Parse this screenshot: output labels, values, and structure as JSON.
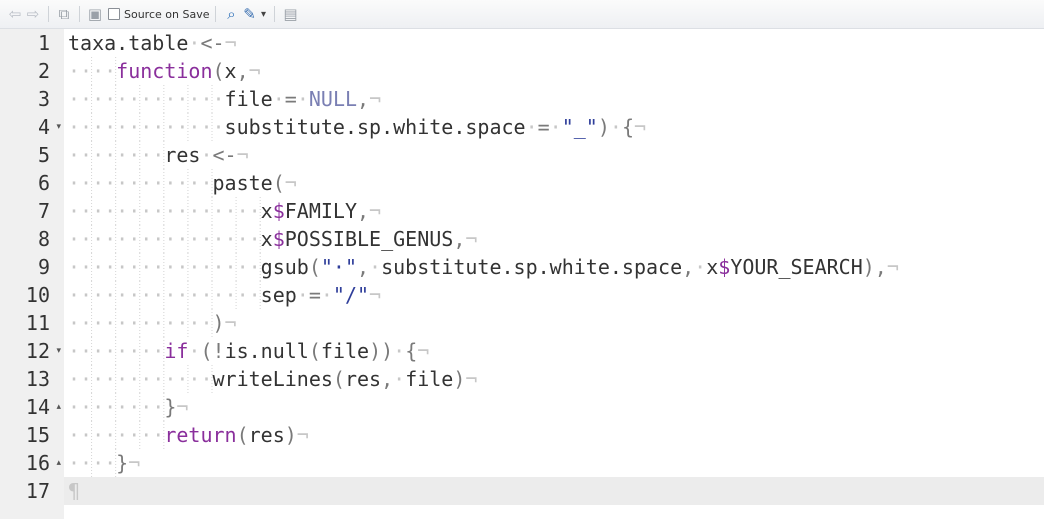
{
  "toolbar": {
    "items": [
      {
        "name": "back-icon",
        "type": "icon",
        "glyph": "⇦",
        "color": "#b9bec6"
      },
      {
        "name": "forward-icon",
        "type": "icon",
        "glyph": "⇨",
        "color": "#b9bec6"
      },
      {
        "name": "sep"
      },
      {
        "name": "show-in-window-icon",
        "type": "icon",
        "glyph": "⧉",
        "color": "#9aa0a8"
      },
      {
        "name": "sep"
      },
      {
        "name": "save-icon",
        "type": "icon",
        "glyph": "▣",
        "color": "#9aa0a8"
      },
      {
        "name": "source-on-save-checkbox",
        "type": "checkbox",
        "label": "Source on Save",
        "checked": false
      },
      {
        "name": "sep"
      },
      {
        "name": "search-icon",
        "type": "icon",
        "glyph": "⌕",
        "color": "#2d6fb8"
      },
      {
        "name": "code-tools-icon",
        "type": "icon",
        "glyph": "✎",
        "color": "#3a6fb0"
      },
      {
        "name": "dropdown-caret-icon",
        "type": "icon",
        "glyph": "▾",
        "color": "#444444"
      },
      {
        "name": "sep"
      },
      {
        "name": "document-outline-icon",
        "type": "icon",
        "glyph": "▤",
        "color": "#9aa0a8"
      }
    ]
  },
  "editor": {
    "whitespace_dot": "·",
    "eol_mark": "¬",
    "pilcrow": "¶",
    "active_line": 17,
    "lines": [
      {
        "num": "1",
        "fold": "",
        "indent": 0,
        "tokens": [
          [
            "id",
            "taxa.table"
          ],
          [
            "ws",
            "·"
          ],
          [
            "op",
            "<-"
          ],
          [
            "ws",
            "¬"
          ]
        ]
      },
      {
        "num": "2",
        "fold": "",
        "indent": 4,
        "tokens": [
          [
            "kw",
            "function"
          ],
          [
            "op",
            "("
          ],
          [
            "id",
            "x"
          ],
          [
            "op",
            ","
          ],
          [
            "ws",
            "¬"
          ]
        ]
      },
      {
        "num": "3",
        "fold": "",
        "indent": 13,
        "tokens": [
          [
            "id",
            "file"
          ],
          [
            "ws",
            "·"
          ],
          [
            "op",
            "="
          ],
          [
            "ws",
            "·"
          ],
          [
            "cst",
            "NULL"
          ],
          [
            "op",
            ","
          ],
          [
            "ws",
            "¬"
          ]
        ]
      },
      {
        "num": "4",
        "fold": "▾",
        "indent": 13,
        "tokens": [
          [
            "id",
            "substitute.sp.white.space"
          ],
          [
            "ws",
            "·"
          ],
          [
            "op",
            "="
          ],
          [
            "ws",
            "·"
          ],
          [
            "str",
            "\"_\""
          ],
          [
            "op",
            ")"
          ],
          [
            "ws",
            "·"
          ],
          [
            "op",
            "{"
          ],
          [
            "ws",
            "¬"
          ]
        ]
      },
      {
        "num": "5",
        "fold": "",
        "indent": 8,
        "tokens": [
          [
            "id",
            "res"
          ],
          [
            "ws",
            "·"
          ],
          [
            "op",
            "<-"
          ],
          [
            "ws",
            "¬"
          ]
        ]
      },
      {
        "num": "6",
        "fold": "",
        "indent": 12,
        "tokens": [
          [
            "id",
            "paste"
          ],
          [
            "op",
            "("
          ],
          [
            "ws",
            "¬"
          ]
        ]
      },
      {
        "num": "7",
        "fold": "",
        "indent": 16,
        "tokens": [
          [
            "id",
            "x"
          ],
          [
            "dl",
            "$"
          ],
          [
            "id",
            "FAMILY"
          ],
          [
            "op",
            ","
          ],
          [
            "ws",
            "¬"
          ]
        ]
      },
      {
        "num": "8",
        "fold": "",
        "indent": 16,
        "tokens": [
          [
            "id",
            "x"
          ],
          [
            "dl",
            "$"
          ],
          [
            "id",
            "POSSIBLE_GENUS"
          ],
          [
            "op",
            ","
          ],
          [
            "ws",
            "¬"
          ]
        ]
      },
      {
        "num": "9",
        "fold": "",
        "indent": 16,
        "tokens": [
          [
            "id",
            "gsub"
          ],
          [
            "op",
            "("
          ],
          [
            "str",
            "\"·\""
          ],
          [
            "op",
            ","
          ],
          [
            "ws",
            "·"
          ],
          [
            "id",
            "substitute.sp.white.space"
          ],
          [
            "op",
            ","
          ],
          [
            "ws",
            "·"
          ],
          [
            "id",
            "x"
          ],
          [
            "dl",
            "$"
          ],
          [
            "id",
            "YOUR_SEARCH"
          ],
          [
            "op",
            "),"
          ],
          [
            "ws",
            "¬"
          ]
        ]
      },
      {
        "num": "10",
        "fold": "",
        "indent": 16,
        "tokens": [
          [
            "id",
            "sep"
          ],
          [
            "ws",
            "·"
          ],
          [
            "op",
            "="
          ],
          [
            "ws",
            "·"
          ],
          [
            "str",
            "\"/\""
          ],
          [
            "ws",
            "¬"
          ]
        ]
      },
      {
        "num": "11",
        "fold": "",
        "indent": 12,
        "tokens": [
          [
            "op",
            ")"
          ],
          [
            "ws",
            "¬"
          ]
        ]
      },
      {
        "num": "12",
        "fold": "▾",
        "indent": 8,
        "tokens": [
          [
            "kw",
            "if"
          ],
          [
            "ws",
            "·"
          ],
          [
            "op",
            "(!"
          ],
          [
            "id",
            "is.null"
          ],
          [
            "op",
            "("
          ],
          [
            "id",
            "file"
          ],
          [
            "op",
            "))"
          ],
          [
            "ws",
            "·"
          ],
          [
            "op",
            "{"
          ],
          [
            "ws",
            "¬"
          ]
        ]
      },
      {
        "num": "13",
        "fold": "",
        "indent": 12,
        "tokens": [
          [
            "id",
            "writeLines"
          ],
          [
            "op",
            "("
          ],
          [
            "id",
            "res"
          ],
          [
            "op",
            ","
          ],
          [
            "ws",
            "·"
          ],
          [
            "id",
            "file"
          ],
          [
            "op",
            ")"
          ],
          [
            "ws",
            "¬"
          ]
        ]
      },
      {
        "num": "14",
        "fold": "▴",
        "indent": 8,
        "tokens": [
          [
            "op",
            "}"
          ],
          [
            "ws",
            "¬"
          ]
        ]
      },
      {
        "num": "15",
        "fold": "",
        "indent": 8,
        "tokens": [
          [
            "kw",
            "return"
          ],
          [
            "op",
            "("
          ],
          [
            "id",
            "res"
          ],
          [
            "op",
            ")"
          ],
          [
            "ws",
            "¬"
          ]
        ]
      },
      {
        "num": "16",
        "fold": "▴",
        "indent": 4,
        "tokens": [
          [
            "op",
            "}"
          ],
          [
            "ws",
            "¬"
          ]
        ]
      },
      {
        "num": "17",
        "fold": "",
        "indent": 0,
        "tokens": [
          [
            "ws",
            "¶"
          ]
        ]
      }
    ]
  }
}
